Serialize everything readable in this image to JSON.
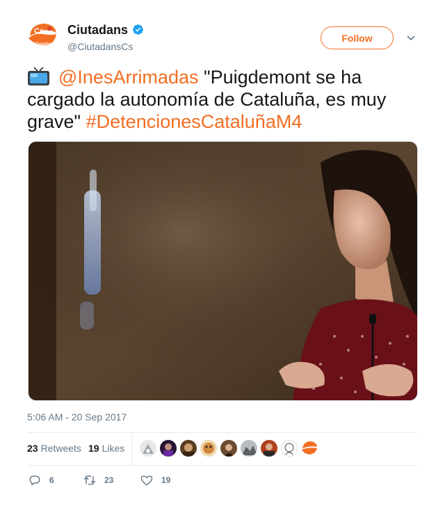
{
  "account": {
    "name": "Ciutadans",
    "handle": "@CiutadansCs",
    "logo_text": "Cs",
    "logo_subtext": "Ciutadans"
  },
  "header": {
    "follow_label": "Follow"
  },
  "tweet": {
    "mention": "@InesArrimadas",
    "text_main": " \"Puigdemont se ha cargado la autonomía de Cataluña, es muy grave\" ",
    "hashtag": "#DetencionesCataluñaM4",
    "timestamp": "5:06 AM - 20 Sep 2017"
  },
  "stats": {
    "retweets_count": "23",
    "retweets_label": "Retweets",
    "likes_count": "19",
    "likes_label": "Likes"
  },
  "actions": {
    "reply_count": "6",
    "retweet_count": "23",
    "like_count": "19"
  },
  "colors": {
    "brand_orange": "#f26e22",
    "verified_blue": "#1da1f2",
    "secondary_text": "#657786"
  },
  "icons": [
    "tv-icon",
    "verified-badge-icon",
    "chevron-down-icon",
    "reply-icon",
    "retweet-icon",
    "heart-icon"
  ]
}
